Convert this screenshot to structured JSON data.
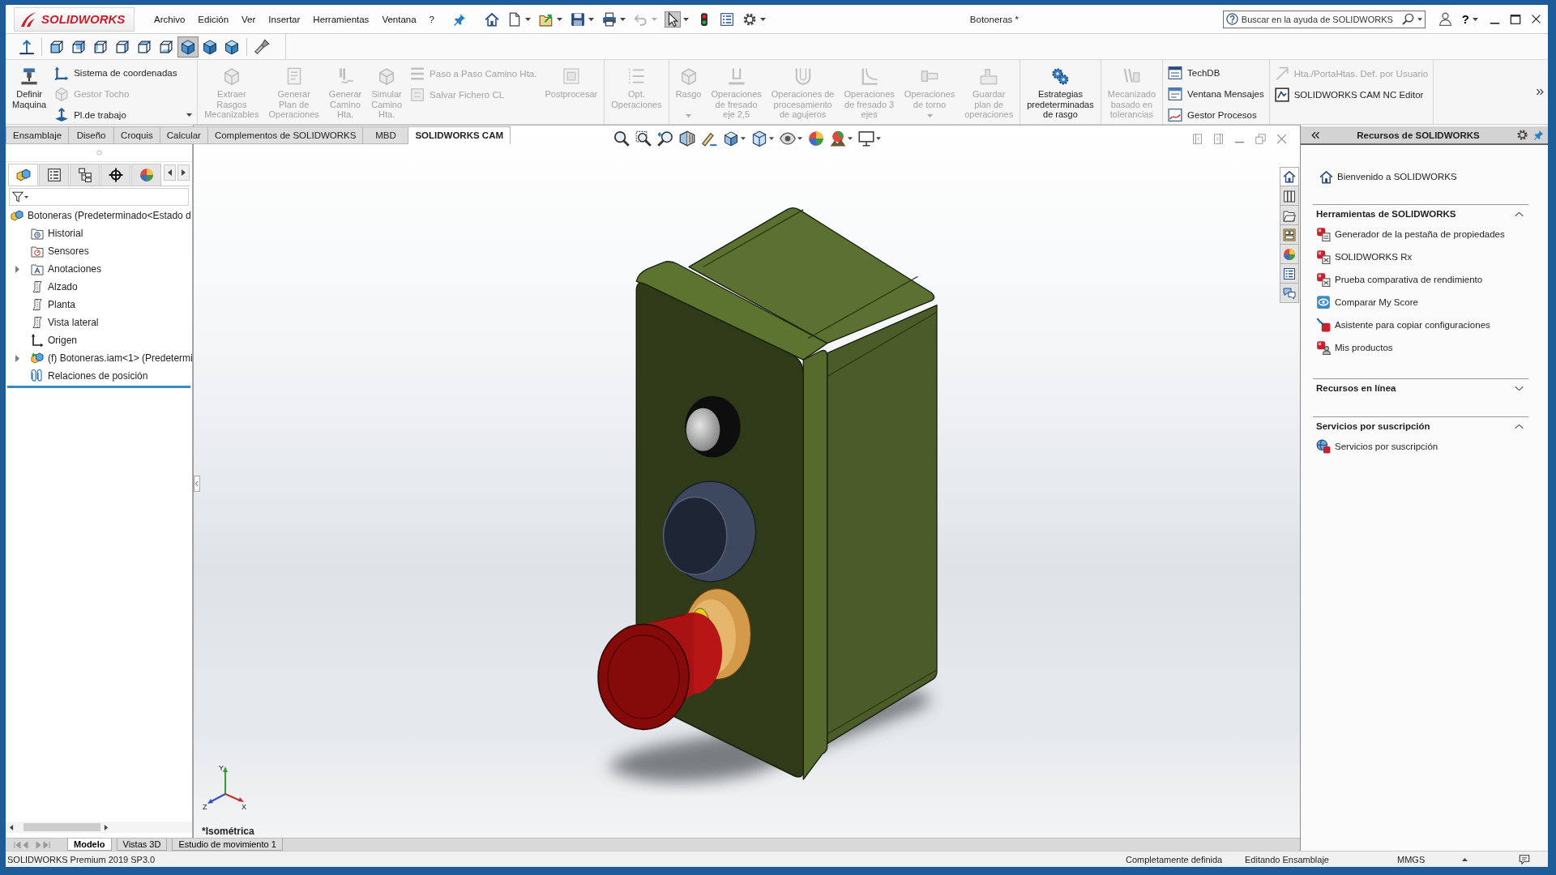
{
  "window": {
    "title": "Botoneras *"
  },
  "logo": "SOLIDWORKS",
  "menu": [
    "Archivo",
    "Edición",
    "Ver",
    "Insertar",
    "Herramientas",
    "Ventana",
    "?"
  ],
  "quick_access": [
    {
      "kind": "home",
      "dropdown": false,
      "disabled": false,
      "selected": false
    },
    {
      "kind": "new",
      "dropdown": true,
      "disabled": false,
      "selected": false
    },
    {
      "kind": "open",
      "dropdown": true,
      "disabled": false,
      "selected": false
    },
    {
      "kind": "save",
      "dropdown": true,
      "disabled": false,
      "selected": false
    },
    {
      "kind": "print",
      "dropdown": true,
      "disabled": false,
      "selected": false
    },
    {
      "kind": "undo",
      "dropdown": true,
      "disabled": true,
      "selected": false
    },
    {
      "kind": "select",
      "dropdown": true,
      "disabled": false,
      "selected": true
    },
    {
      "kind": "rebuild",
      "dropdown": false,
      "disabled": false,
      "selected": false
    },
    {
      "kind": "file-properties",
      "dropdown": false,
      "disabled": false,
      "selected": false
    },
    {
      "kind": "options",
      "dropdown": true,
      "disabled": false,
      "selected": false
    }
  ],
  "search": {
    "placeholder": "Buscar en la ayuda de SOLIDWORKS"
  },
  "help": "?",
  "view_toolbar": [
    {
      "kind": "normal-to",
      "selected": false
    },
    {
      "kind": "front",
      "selected": false
    },
    {
      "kind": "back",
      "selected": false
    },
    {
      "kind": "left",
      "selected": false
    },
    {
      "kind": "right",
      "selected": false
    },
    {
      "kind": "top",
      "selected": false
    },
    {
      "kind": "bottom",
      "selected": false
    },
    {
      "kind": "isometric",
      "selected": true
    },
    {
      "kind": "trimetric",
      "selected": false
    },
    {
      "kind": "dimetric",
      "selected": false
    },
    {
      "kind": "flashlight",
      "selected": false
    }
  ],
  "command_manager": [
    {
      "columns": [
        {
          "kind": "big",
          "label": "Definir\nMaquina",
          "disabled": false,
          "dropdown": false
        },
        {
          "kind": "stack",
          "items": [
            {
              "label": "Sistema de coordenadas",
              "disabled": false,
              "dropdown": false
            },
            {
              "label": "Gestor Tocho",
              "disabled": true,
              "dropdown": false
            },
            {
              "label": "Pl.de trabajo",
              "disabled": false,
              "dropdown": true
            }
          ]
        }
      ]
    },
    {
      "columns": [
        {
          "kind": "big",
          "label": "Extraer\nRasgos\nMecanizables",
          "disabled": true,
          "dropdown": false
        },
        {
          "kind": "big",
          "label": "Generar\nPlan de\nOperaciones",
          "disabled": true,
          "dropdown": false
        },
        {
          "kind": "big",
          "label": "Generar\nCamino\nHta.",
          "disabled": true,
          "dropdown": false
        },
        {
          "kind": "big",
          "label": "Simular\nCamino\nHta.",
          "disabled": true,
          "dropdown": false
        },
        {
          "kind": "stack",
          "items": [
            {
              "label": "Paso a Paso Camino Hta.",
              "disabled": true,
              "dropdown": false
            },
            {
              "label": "Salvar Fichero CL",
              "disabled": true,
              "dropdown": false
            }
          ]
        },
        {
          "kind": "big",
          "label": "Postprocesar",
          "disabled": true,
          "dropdown": false
        }
      ]
    },
    {
      "columns": [
        {
          "kind": "big",
          "label": "Opt.\nOperaciones",
          "disabled": true,
          "dropdown": false
        }
      ]
    },
    {
      "columns": [
        {
          "kind": "big",
          "label": "Rasgo",
          "disabled": true,
          "dropdown": true
        },
        {
          "kind": "big",
          "label": "Operaciones\nde fresado\neje 2,5",
          "disabled": true,
          "dropdown": false
        },
        {
          "kind": "big",
          "label": "Operaciones de\nprocesamiento\nde agujeros",
          "disabled": true,
          "dropdown": false
        },
        {
          "kind": "big",
          "label": "Operaciones\nde fresado 3\nejes",
          "disabled": true,
          "dropdown": false
        },
        {
          "kind": "big",
          "label": "Operaciones\nde torno",
          "disabled": true,
          "dropdown": true
        },
        {
          "kind": "big",
          "label": "Guardar\nplan de\noperaciones",
          "disabled": true,
          "dropdown": false
        }
      ]
    },
    {
      "columns": [
        {
          "kind": "big",
          "label": "Estrategias\npredeterminadas\nde rasgo",
          "disabled": false,
          "dropdown": false
        }
      ]
    },
    {
      "columns": [
        {
          "kind": "big",
          "label": "Mecanizado\nbasado en\ntolerancias",
          "disabled": true,
          "dropdown": false
        }
      ]
    },
    {
      "columns": [
        {
          "kind": "stack",
          "items": [
            {
              "label": "TechDB",
              "disabled": false,
              "dropdown": false
            },
            {
              "label": "Ventana Mensajes",
              "disabled": false,
              "dropdown": false
            },
            {
              "label": "Gestor Procesos",
              "disabled": false,
              "dropdown": false
            }
          ]
        }
      ]
    },
    {
      "columns": [
        {
          "kind": "stack",
          "items": [
            {
              "label": "Hta./PortaHtas. Def. por Usuario",
              "disabled": true,
              "dropdown": false
            },
            {
              "label": "SOLIDWORKS CAM NC Editor",
              "disabled": false,
              "dropdown": false
            }
          ]
        }
      ]
    }
  ],
  "tabs": [
    {
      "label": "Ensamblaje",
      "selected": false
    },
    {
      "label": "Diseño",
      "selected": false
    },
    {
      "label": "Croquis",
      "selected": false
    },
    {
      "label": "Calcular",
      "selected": false
    },
    {
      "label": "Complementos de SOLIDWORKS",
      "selected": false
    },
    {
      "label": "MBD",
      "selected": false
    },
    {
      "label": "SOLIDWORKS CAM",
      "selected": true
    }
  ],
  "panel_tabs": [
    {
      "kind": "feature-manager",
      "selected": true
    },
    {
      "kind": "property-manager",
      "selected": false
    },
    {
      "kind": "configuration-manager",
      "selected": false
    },
    {
      "kind": "dimxpert",
      "selected": false
    },
    {
      "kind": "display-manager",
      "selected": false
    }
  ],
  "feature_tree": [
    {
      "label": "Botoneras (Predeterminado<Estado d",
      "kind": "assembly",
      "children": [
        {
          "label": "Historial",
          "kind": "history"
        },
        {
          "label": "Sensores",
          "kind": "sensors"
        },
        {
          "label": "Anotaciones",
          "kind": "annotations",
          "expanded": false
        },
        {
          "label": "Alzado",
          "kind": "plane"
        },
        {
          "label": "Planta",
          "kind": "plane"
        },
        {
          "label": "Vista lateral",
          "kind": "plane"
        },
        {
          "label": "Origen",
          "kind": "origin"
        },
        {
          "label": "(f) Botoneras.iam<1> (Predetermi",
          "kind": "subassembly",
          "expanded": false
        },
        {
          "label": "Relaciones de posición",
          "kind": "mates"
        }
      ]
    }
  ],
  "task_tabs": [
    {
      "kind": "home",
      "selected": true
    },
    {
      "kind": "library",
      "selected": false
    },
    {
      "kind": "explorer",
      "selected": false
    },
    {
      "kind": "view-palette",
      "selected": false
    },
    {
      "kind": "appearances",
      "selected": false
    },
    {
      "kind": "properties",
      "selected": false
    },
    {
      "kind": "forum",
      "selected": false
    }
  ],
  "task_pane": {
    "title": "Recursos de SOLIDWORKS",
    "welcome": "Bienvenido a SOLIDWORKS",
    "sections": [
      {
        "title": "Herramientas de SOLIDWORKS",
        "expanded": true,
        "items": [
          "Generador de la pestaña de propiedades",
          "SOLIDWORKS Rx",
          "Prueba comparativa de rendimiento",
          "Comparar My Score",
          "Asistente para copiar configuraciones",
          "Mis productos"
        ]
      },
      {
        "title": "Recursos en línea",
        "expanded": false
      },
      {
        "title": "Servicios por suscripción",
        "expanded": true,
        "items": [
          "Servicios por suscripción"
        ]
      }
    ]
  },
  "triad": [
    "Y",
    "X",
    "Z"
  ],
  "view_label": "*Isométrica",
  "model_tabs": [
    {
      "label": "Modelo",
      "selected": true
    },
    {
      "label": "Vistas 3D",
      "selected": false
    },
    {
      "label": "Estudio de movimiento 1",
      "selected": false
    }
  ],
  "status_bar": {
    "product": "SOLIDWORKS Premium 2019 SP3.0",
    "state": "Completamente definida",
    "mode": "Editando Ensamblaje",
    "units": "MMGS"
  }
}
